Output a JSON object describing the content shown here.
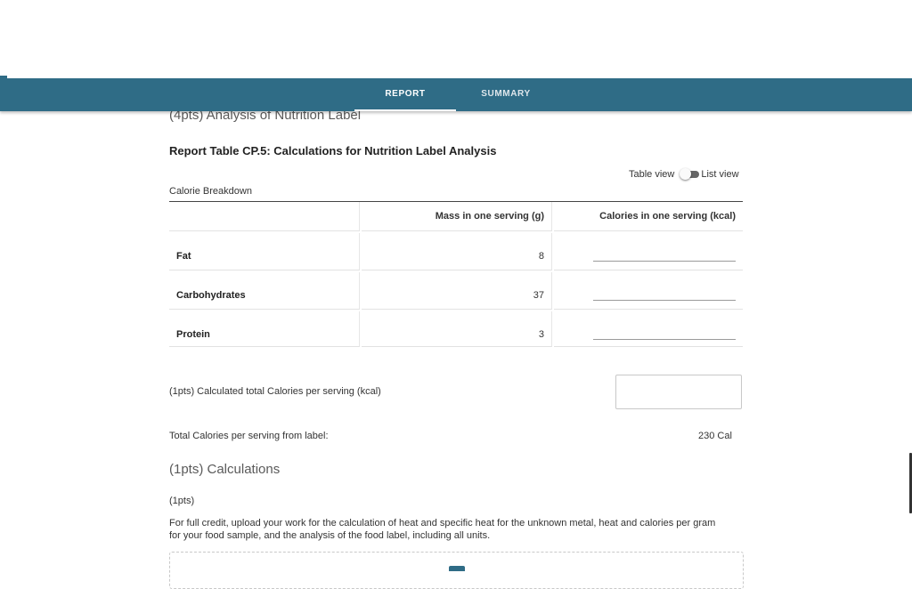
{
  "nav": {
    "tabs": [
      {
        "label": "REPORT",
        "active": true
      },
      {
        "label": "SUMMARY",
        "active": false
      }
    ]
  },
  "section_top": {
    "title": "(4pts) Analysis of Nutrition Label"
  },
  "report": {
    "title": "Report Table CP.5: Calculations for Nutrition Label Analysis",
    "view_toggle": {
      "left": "Table view",
      "right": "List view"
    },
    "caption": "Calorie Breakdown",
    "columns": [
      "",
      "Mass in one serving (g)",
      "Calories in one serving (kcal)"
    ],
    "rows": [
      {
        "label": "Fat",
        "mass": "8",
        "calories": ""
      },
      {
        "label": "Carbohydrates",
        "mass": "37",
        "calories": ""
      },
      {
        "label": "Protein",
        "mass": "3",
        "calories": ""
      }
    ]
  },
  "calc_total": {
    "label": "(1pts)  Calculated total Calories per serving (kcal)",
    "value": ""
  },
  "label_total": {
    "label": "Total Calories per serving from label:",
    "value": "230 Cal"
  },
  "calculations": {
    "heading": "(1pts) Calculations",
    "pts": "(1pts)",
    "instructions": "For full credit, upload your work for the calculation of heat and specific heat for the unknown metal, heat and calories per gram for your food sample, and the analysis of the food label, including all units."
  },
  "colors": {
    "nav_bg": "#2f6c86"
  }
}
